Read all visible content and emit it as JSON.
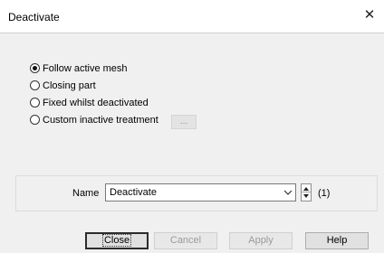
{
  "window": {
    "title": "Deactivate",
    "close_symbol": "✕"
  },
  "options": [
    {
      "label": "Follow active mesh",
      "checked": true
    },
    {
      "label": "Closing part",
      "checked": false
    },
    {
      "label": "Fixed whilst deactivated",
      "checked": false
    },
    {
      "label": "Custom inactive treatment",
      "checked": false
    }
  ],
  "custom_button_label": "...",
  "name_field": {
    "label": "Name",
    "value": "Deactivate",
    "count": "(1)"
  },
  "buttons": {
    "close": "Close",
    "cancel": "Cancel",
    "apply": "Apply",
    "help": "Help"
  }
}
